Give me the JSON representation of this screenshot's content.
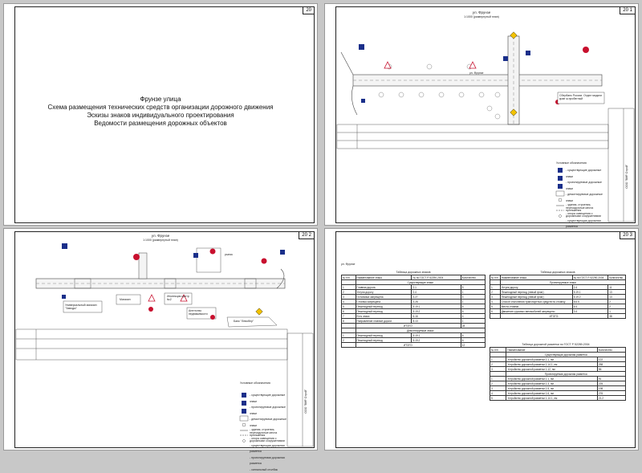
{
  "sheets": [
    {
      "page": "20",
      "sub": "",
      "title_lines": [
        "Фрунзе улица",
        "Схема размещения технических средств организации дорожного движения",
        "Эскизы знаков индивидуального проектирования",
        "Ведомости размещения дорожных объектов"
      ]
    },
    {
      "page": "20",
      "sub": "1",
      "street": "ул. Фрунзе",
      "scale": "1:1000 (развернутый план)",
      "map_street": "ул. Фрунзе",
      "callout": "Сбербанк России. Отдел мидиги крае ж.пробегный",
      "legend_title": "Условные обозначения",
      "legend": [
        "- существующие дорожные знаки",
        "- проектируемые дорожные знаки",
        "- демонтируемые дорожные знаки",
        "- здания, строения, пересадочные места протяжения",
        "- опора освещения с дорожными сооружениями",
        "- существующая дорожная разметка",
        "- проектируемая дорожная разметка",
        "- сигнальный столбик"
      ],
      "stamp": "ООО \"ВИР Строй\""
    },
    {
      "page": "20",
      "sub": "2",
      "street": "ул. Фрунзе",
      "scale": "1:1000 (развернутый план)",
      "labels": [
        "Универсальный магазин \"Заводы\"",
        "Магазин",
        "Инспекция центр №2",
        "Агентство недвижимости",
        "Банк \"Левобер\"",
        "рынок"
      ],
      "legend_title": "Условные обозначения",
      "legend": [
        "- существующие дорожные знаки",
        "- проектируемые дорожные знаки",
        "- демонтируемые дорожные знаки",
        "- здания, строения, пересадочные места протяжения",
        "- опора освещения с дорожными сооружениями",
        "- существующая дорожная разметка",
        "- проектируемая дорожная разметка",
        "- сигнальный столбик"
      ],
      "stamp": "ООО \"ВИР Строй\""
    },
    {
      "page": "20",
      "sub": "3",
      "street": "ул. Фрунзе",
      "t1_title": "Таблица дорожных знаков",
      "t1_head": [
        "№ п/п",
        "Наименование знака",
        "№ по ГОСТ Р 52290-2004",
        "Количество"
      ],
      "t1_group1": "Существующие знаки",
      "t1_rows1": [
        [
          "1",
          "Главная дорога",
          "2.1",
          "5"
        ],
        [
          "2",
          "Уступи дорогу",
          "2.4",
          "1"
        ],
        [
          "3",
          "Остановка запрещена",
          "3.27",
          "4"
        ],
        [
          "4",
          "Стоянка запрещена",
          "3.28",
          "1"
        ],
        [
          "5",
          "Пешеходный переход",
          "5.19.1",
          "6"
        ],
        [
          "6",
          "Пешеходный переход",
          "5.19.2",
          "6"
        ],
        [
          "7",
          "Есть знаки",
          "6.16",
          "4"
        ],
        [
          "8",
          "Направление главной дороги",
          "8.13",
          "1"
        ]
      ],
      "t1_total1": [
        "ИТОГО:",
        "28"
      ],
      "t1_group2": "Демонтируемые знаки",
      "t1_rows2": [
        [
          "1",
          "Пешеходный переход",
          "5.19.1",
          "6"
        ],
        [
          "2",
          "Пешеходный переход",
          "5.19.2",
          "6"
        ]
      ],
      "t1_total2": [
        "ИТОГО:",
        "12"
      ],
      "t2_title": "Таблица дорожных знаков",
      "t2_head": [
        "№ п/п",
        "Наименование знака",
        "№ по ГОСТ Р 52290-2004",
        "Количество"
      ],
      "t2_group": "Проектируемые знаки",
      "t2_rows": [
        [
          "1",
          "Уступи дорогу",
          "2.4",
          "11"
        ],
        [
          "2",
          "Пешеходный переход (левый флаг)",
          "5.19.1",
          "13"
        ],
        [
          "3",
          "Пешеходный переход (левый флаг)",
          "5.19.2",
          "13"
        ],
        [
          "4",
          "Способ отклонения транспортных средств по стоянку",
          "8.6.5",
          "2"
        ],
        [
          "5",
          "Места стоянки",
          "6.4",
          "2"
        ],
        [
          "6",
          "Движение грузовых автомобилей запрещено",
          "3.4",
          "1"
        ]
      ],
      "t2_total": [
        "ИТОГО:",
        "38"
      ],
      "t3_title": "Таблица дорожной разметки по ГОСТ Р 52289-2004",
      "t3_head": [
        "№ п/п",
        "Наименование",
        "Количество"
      ],
      "t3_group1": "Существующая дорожная разметка",
      "t3_rows1": [
        [
          "1",
          "Устройство дорожной разметки 1.1, пм",
          "122"
        ],
        [
          "2",
          "Устройство дорожной разметки 1.14.1, пм",
          "258"
        ],
        [
          "3",
          "Устройство дорожной разметки 1.12, пм",
          "56"
        ]
      ],
      "t3_group2": "Проектируемая дорожная разметка",
      "t3_rows2": [
        [
          "1",
          "Устройство дорожной разметки 1.1, пм",
          "91"
        ],
        [
          "2",
          "Устройство дорожной разметки 1.3, пм",
          "225"
        ],
        [
          "3",
          "Устройство дорожной разметки 1.5, пм",
          "198"
        ],
        [
          "4",
          "Устройство дорожной разметки 1.6, пм",
          "276"
        ],
        [
          "5",
          "Устройство дорожной разметки 1.14.1, пм",
          "21.2"
        ]
      ]
    }
  ],
  "colors": {
    "sign_blue": "#1a2f8a",
    "sign_red": "#c8102e",
    "sign_yellow": "#f2c200",
    "road": "#444444"
  }
}
